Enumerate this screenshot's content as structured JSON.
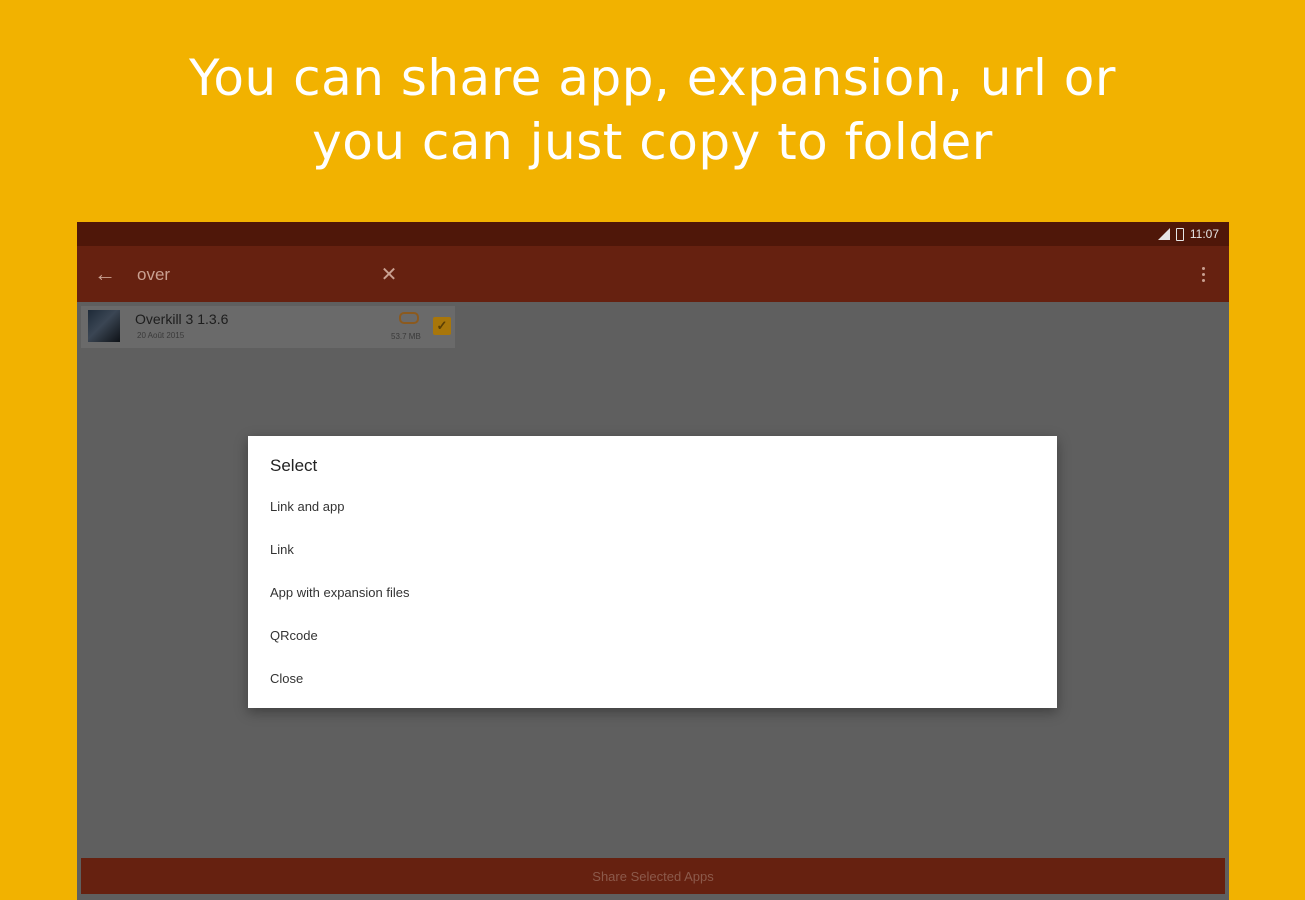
{
  "headline": {
    "line1": "You can share app, expansion, url or",
    "line2": "you can just copy to folder"
  },
  "status_bar": {
    "time": "11:07"
  },
  "toolbar": {
    "search_value": "over",
    "icons": {
      "back": "arrow-left-icon",
      "clear": "close-icon",
      "menu": "more-vert-icon"
    }
  },
  "app_item": {
    "name": "Overkill 3 1.3.6",
    "date": "20 Août 2015",
    "size": "53.7 MB",
    "checked": true
  },
  "dialog": {
    "title": "Select",
    "options": [
      "Link and app",
      "Link",
      "App with expansion files",
      "QRcode",
      "Close"
    ]
  },
  "share_button": {
    "label": "Share Selected Apps"
  },
  "colors": {
    "background": "#F2B200",
    "toolbar": "#662110",
    "statusbar": "#4F1709",
    "scrim": "#5F5F5F",
    "dialog": "#FFFFFF"
  }
}
